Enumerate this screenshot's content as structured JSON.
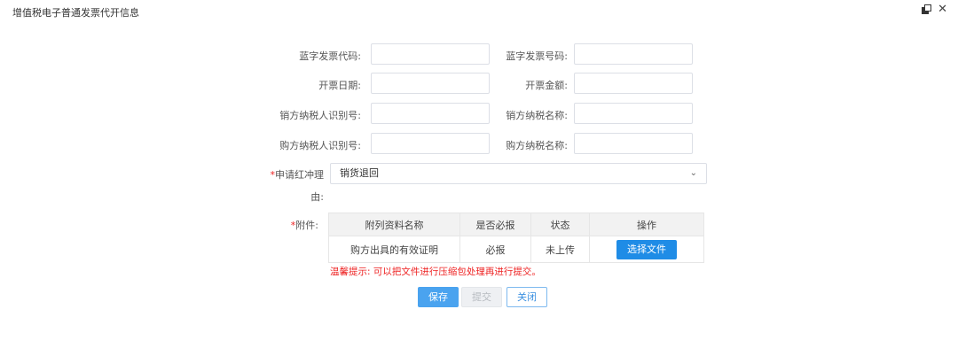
{
  "window": {
    "title": "增值税电子普通发票代开信息",
    "restore_icon": "restore-window-icon",
    "close_glyph": "✕"
  },
  "form": {
    "fields": [
      {
        "label": "蓝字发票代码:",
        "value": ""
      },
      {
        "label": "蓝字发票号码:",
        "value": ""
      },
      {
        "label": "开票日期:",
        "value": ""
      },
      {
        "label": "开票金额:",
        "value": ""
      },
      {
        "label": "销方纳税人识别号:",
        "value": ""
      },
      {
        "label": "销方纳税名称:",
        "value": ""
      },
      {
        "label": "购方纳税人识别号:",
        "value": ""
      },
      {
        "label": "购方纳税名称:",
        "value": ""
      }
    ],
    "reason": {
      "star": "*",
      "label_line1": "申请红冲理",
      "label_line2": "由:",
      "selected": "销货退回",
      "chevron": "⌄"
    },
    "attachment": {
      "star": "*",
      "label": "附件:",
      "columns": [
        "附列资料名称",
        "是否必报",
        "状态",
        "操作"
      ],
      "rows": [
        {
          "name": "购方出具的有效证明",
          "required": "必报",
          "status": "未上传",
          "action": "选择文件"
        }
      ]
    },
    "tip": "温馨提示: 可以把文件进行压缩包处理再进行提交。"
  },
  "buttons": {
    "save": "保存",
    "submit": "提交",
    "close": "关闭"
  },
  "colors": {
    "primary": "#1f8ce6",
    "save_button": "#4aa3ef",
    "required_red": "#e22222",
    "disabled_bg": "#eef0f3"
  }
}
